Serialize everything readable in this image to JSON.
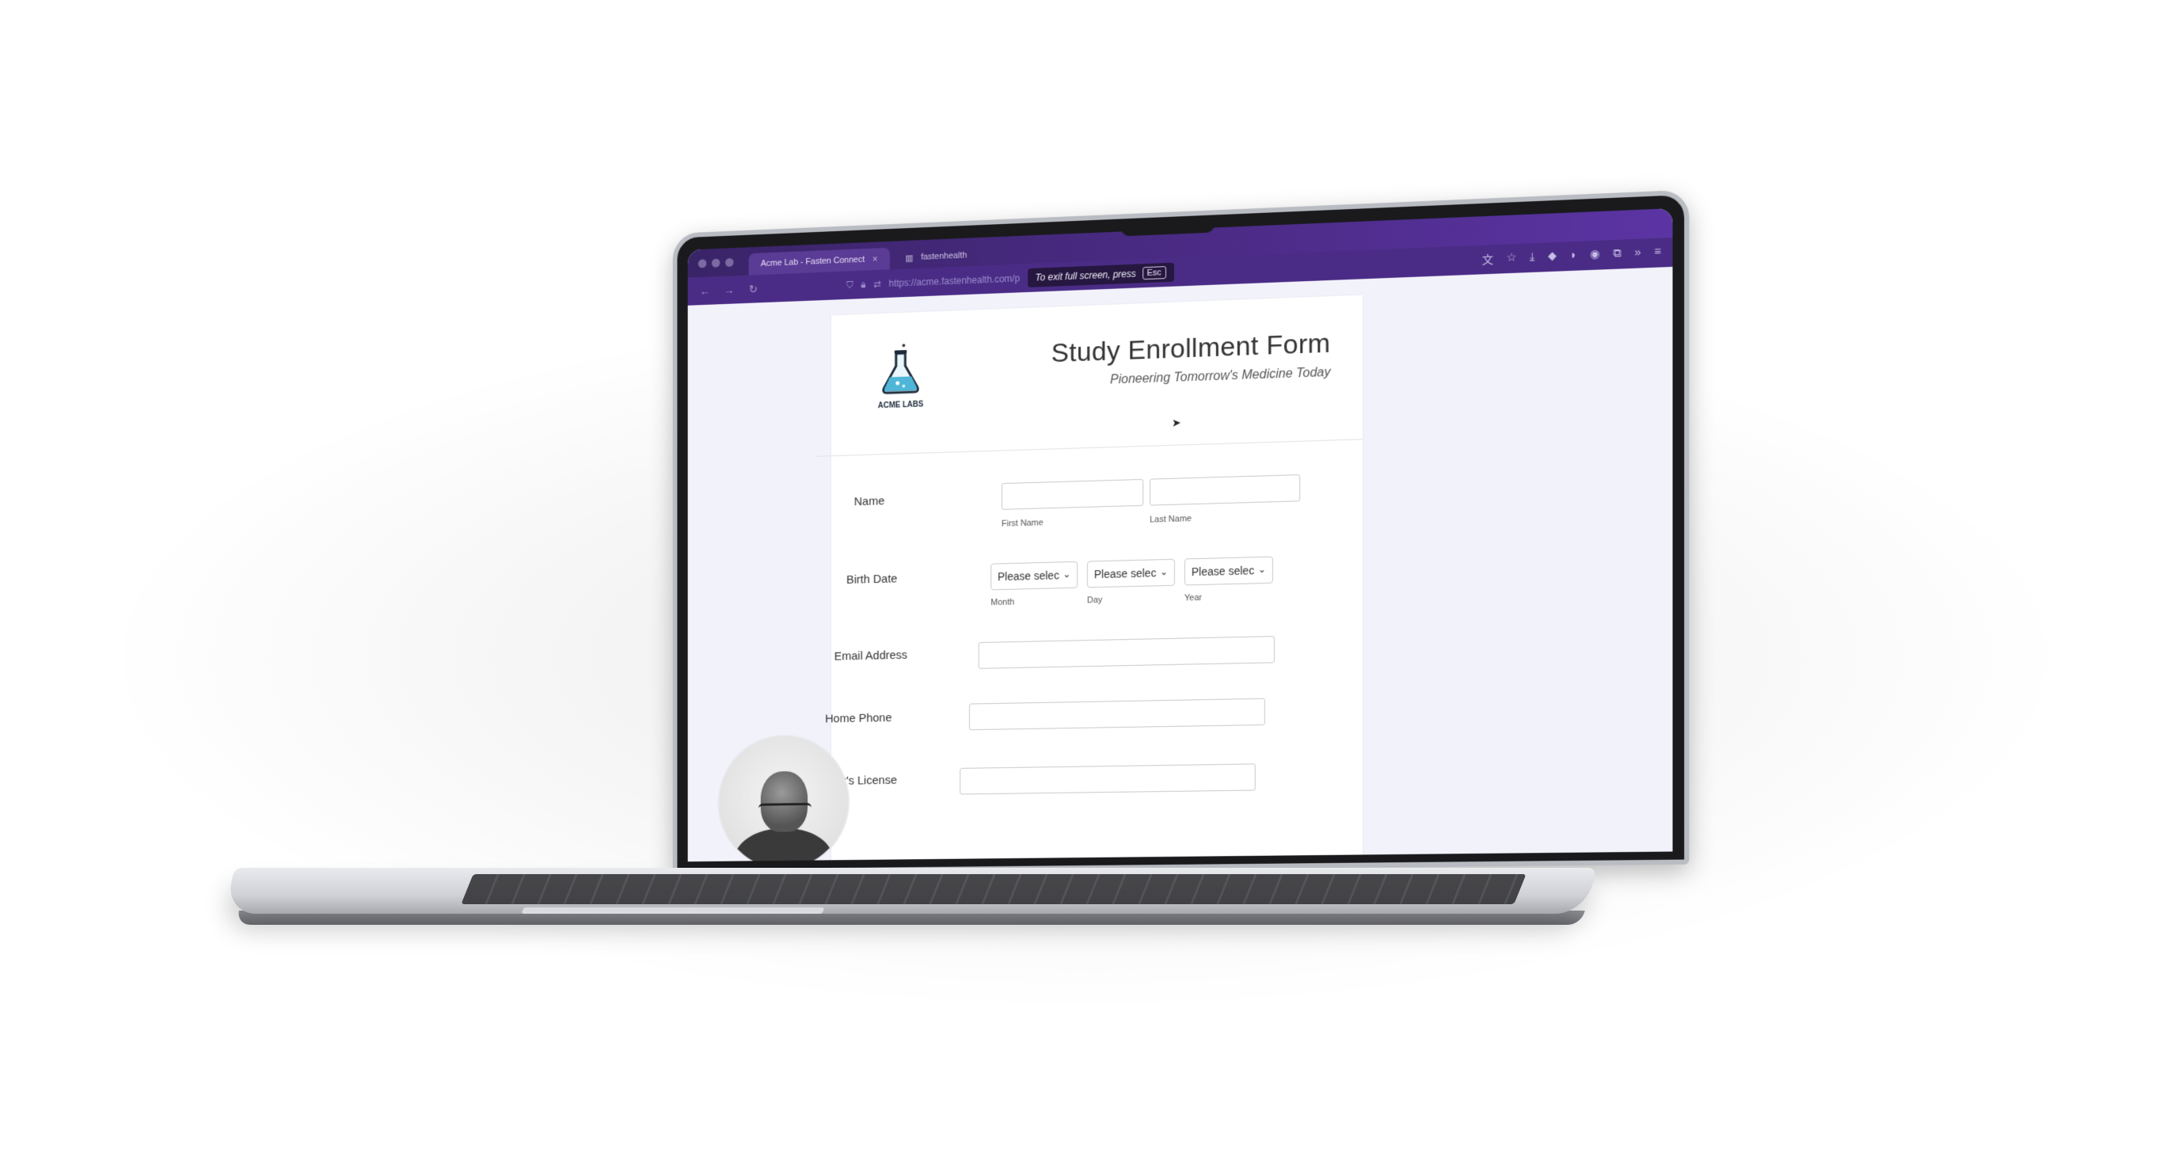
{
  "browser": {
    "tabs": [
      {
        "label": "Acme Lab - Fasten Connect",
        "active": true
      },
      {
        "label": "fastenhealth",
        "active": false
      }
    ],
    "url": "https://acme.fastenhealth.com/p",
    "fullscreen_notice": "To exit full screen, press",
    "esc_key": "Esc"
  },
  "logo": {
    "text": "ACME LABS"
  },
  "form": {
    "title": "Study Enrollment Form",
    "subtitle": "Pioneering Tomorrow's Medicine Today",
    "name": {
      "label": "Name",
      "first_label": "First Name",
      "last_label": "Last Name"
    },
    "birth_date": {
      "label": "Birth Date",
      "month": {
        "value": "Please selec",
        "label": "Month"
      },
      "day": {
        "value": "Please selec",
        "label": "Day"
      },
      "year": {
        "value": "Please selec",
        "label": "Year"
      }
    },
    "email": {
      "label": "Email Address"
    },
    "home_phone": {
      "label": "Home Phone"
    },
    "drivers_license": {
      "label": "Driver's License"
    }
  },
  "colors": {
    "browser_bg": "#4a2c86",
    "page_bg": "#f2f2fb",
    "flask": "#4fb6d8"
  }
}
